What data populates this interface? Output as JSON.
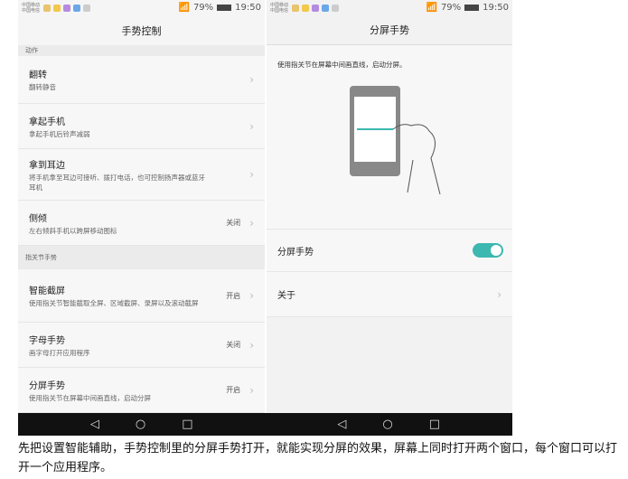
{
  "status": {
    "carrier1": "中国移动",
    "carrier2": "中国电信",
    "battery": "79%",
    "time": "19:50"
  },
  "left": {
    "title": "手势控制",
    "section1": "动作",
    "section2": "指关节手势",
    "rows1": [
      {
        "title": "翻转",
        "sub": "翻转静音",
        "value": ""
      },
      {
        "title": "拿起手机",
        "sub": "拿起手机后铃声减弱",
        "value": ""
      },
      {
        "title": "拿到耳边",
        "sub": "将手机拿至耳边可接听、拨打电话，也可控制扬声器或蓝牙耳机",
        "value": ""
      },
      {
        "title": "侧倾",
        "sub": "左右倾斜手机以跨屏移动图标",
        "value": "关闭"
      }
    ],
    "rows2": [
      {
        "title": "智能截屏",
        "sub": "使用指关节智能截取全屏、区域截屏、录屏以及滚动截屏",
        "value": "开启"
      },
      {
        "title": "字母手势",
        "sub": "画字母打开应用程序",
        "value": "关闭"
      },
      {
        "title": "分屏手势",
        "sub": "使用指关节在屏幕中间画直线，启动分屏",
        "value": "开启"
      }
    ]
  },
  "right": {
    "title": "分屏手势",
    "description": "使用指关节在屏幕中间画直线，启动分屏。",
    "toggle_label": "分屏手势",
    "toggle_on": true,
    "about": "关于"
  },
  "nav": {
    "back": "◁",
    "home": "○",
    "recent": "□"
  },
  "caption": "先把设置智能辅助，手势控制里的分屏手势打开，就能实现分屏的效果，屏幕上同时打开两个窗口，每个窗口可以打开一个应用程序。",
  "colors": {
    "accent": "#3cb8b0"
  }
}
